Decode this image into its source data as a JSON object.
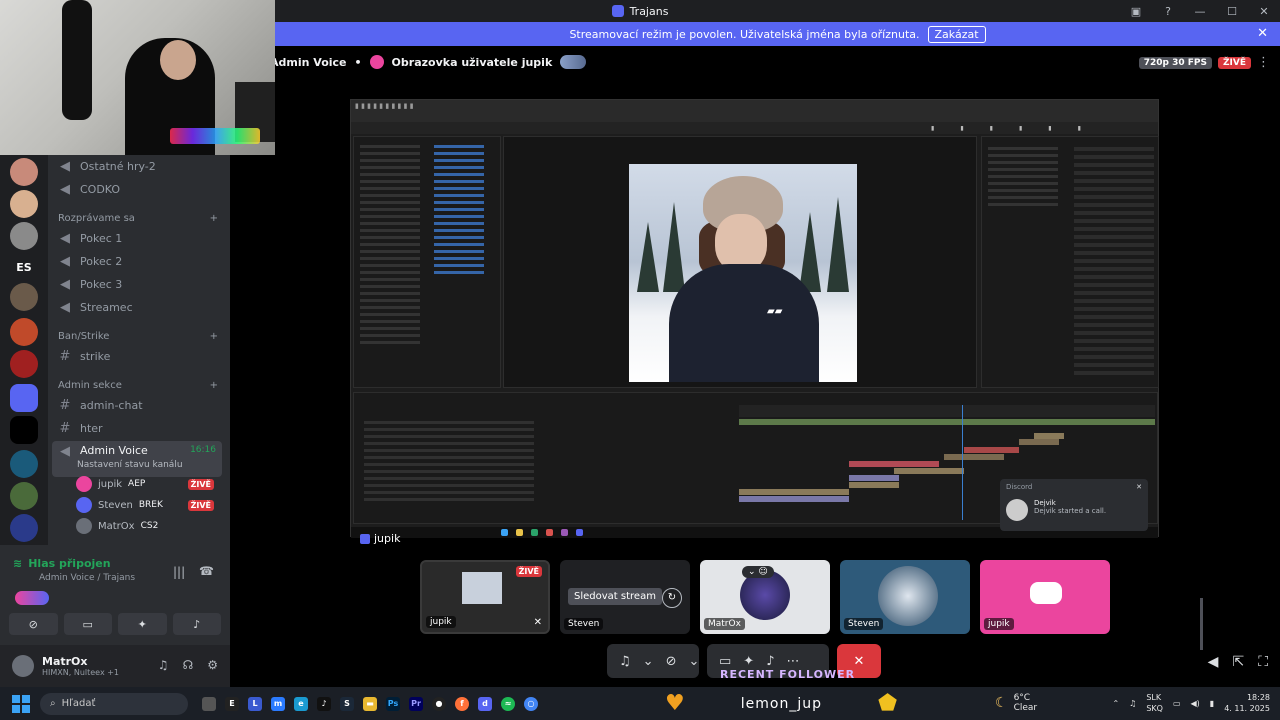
{
  "window": {
    "title": "Trajans"
  },
  "banner": {
    "text": "Streamovací režim je povolen. Uživatelská jména byla oříznuta.",
    "button": "Zakázat"
  },
  "stage_header": {
    "channel": "Admin Voice",
    "separator": "•",
    "stream_title": "Obrazovka uživatele jupik",
    "quality": "720p 30 FPS",
    "live": "ŽIVĚ"
  },
  "sidebar": {
    "channels_top": [
      {
        "label": "Ostatné hry-2",
        "icon": "speaker-icon"
      },
      {
        "label": "CODKO",
        "icon": "speaker-icon"
      }
    ],
    "category1": "Rozprávame sa",
    "category1_channels": [
      "Pokec 1",
      "Pokec 2",
      "Pokec 3",
      "Streamec"
    ],
    "category2": "Ban/Strike",
    "category2_channels": [
      "strike"
    ],
    "category3": "Admin sekce",
    "category3_channels": [
      "admin-chat",
      "hter"
    ],
    "active_voice": {
      "label": "Admin Voice",
      "time": "16:16",
      "status": "Nastavení stavu kanálu"
    },
    "members": [
      {
        "name": "jupik",
        "game": "AEP",
        "live": "ŽIVĚ",
        "color": "#eb459e"
      },
      {
        "name": "Steven",
        "game": "BREK",
        "live": "ŽIVĚ",
        "color": "#5865f2"
      },
      {
        "name": "MatrOx",
        "game": "CS2",
        "live": "",
        "color": "#6a6f78"
      }
    ],
    "guild_label": "ES"
  },
  "voice_panel": {
    "status": "Hlas připojen",
    "location": "Admin Voice / Trajans"
  },
  "user": {
    "name": "MatrOx",
    "status": "HIMXN, Nulteex +1"
  },
  "toast": {
    "app": "Discord",
    "name": "Dejvik",
    "message": "Dejvik started a call."
  },
  "tiles": [
    {
      "name": "jupik",
      "live": "ŽIVĚ"
    },
    {
      "name": "Steven",
      "action": "Sledovat stream"
    },
    {
      "name": "MatrOx"
    },
    {
      "name": "Steven"
    },
    {
      "name": "jupik"
    }
  ],
  "stream_overlay_name": "jupik",
  "follower": "RECENT FOLLOWER",
  "follower_name": "lemon_jup",
  "taskbar": {
    "search": "Hľadať",
    "weather_temp": "6°C",
    "weather_desc": "Clear",
    "lang1": "SLK",
    "lang2": "SKQ",
    "time": "18:28",
    "date": "4. 11. 2025"
  },
  "colors": {
    "accent": "#5865f2",
    "live": "#da373c",
    "online": "#23a55a",
    "bg": "#2b2d31"
  }
}
